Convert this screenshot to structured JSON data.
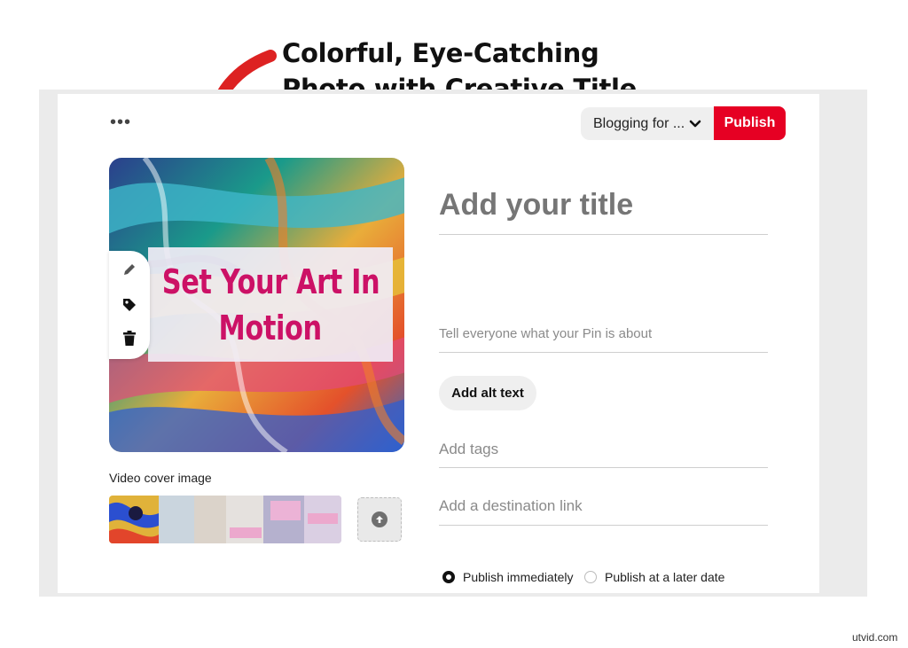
{
  "annotation": {
    "line1": "Colorful, Eye-Catching",
    "line2": "Photo with Creative Title"
  },
  "header": {
    "more_label": "•••",
    "board_select_value": "Blogging for ...",
    "chevron_icon": "chevron-down-icon",
    "publish_label": "Publish"
  },
  "pin": {
    "overlay_line1": "Set Your Art In",
    "overlay_line2": "Motion",
    "tools": [
      "pencil-icon",
      "tag-icon",
      "trash-icon"
    ]
  },
  "form": {
    "title_placeholder": "Add your title",
    "description_placeholder": "Tell everyone what your Pin is about",
    "alt_text_label": "Add alt text",
    "tags_placeholder": "Add tags",
    "link_placeholder": "Add a destination link"
  },
  "video_cover": {
    "label": "Video cover image"
  },
  "publish_options": {
    "immediately": "Publish immediately",
    "later": "Publish at a later date",
    "selected": "immediately"
  },
  "watermark": "utvid.com",
  "colors": {
    "brand_red": "#e60023",
    "overlay_text": "#cc1166",
    "arrow": "#dd2222"
  }
}
